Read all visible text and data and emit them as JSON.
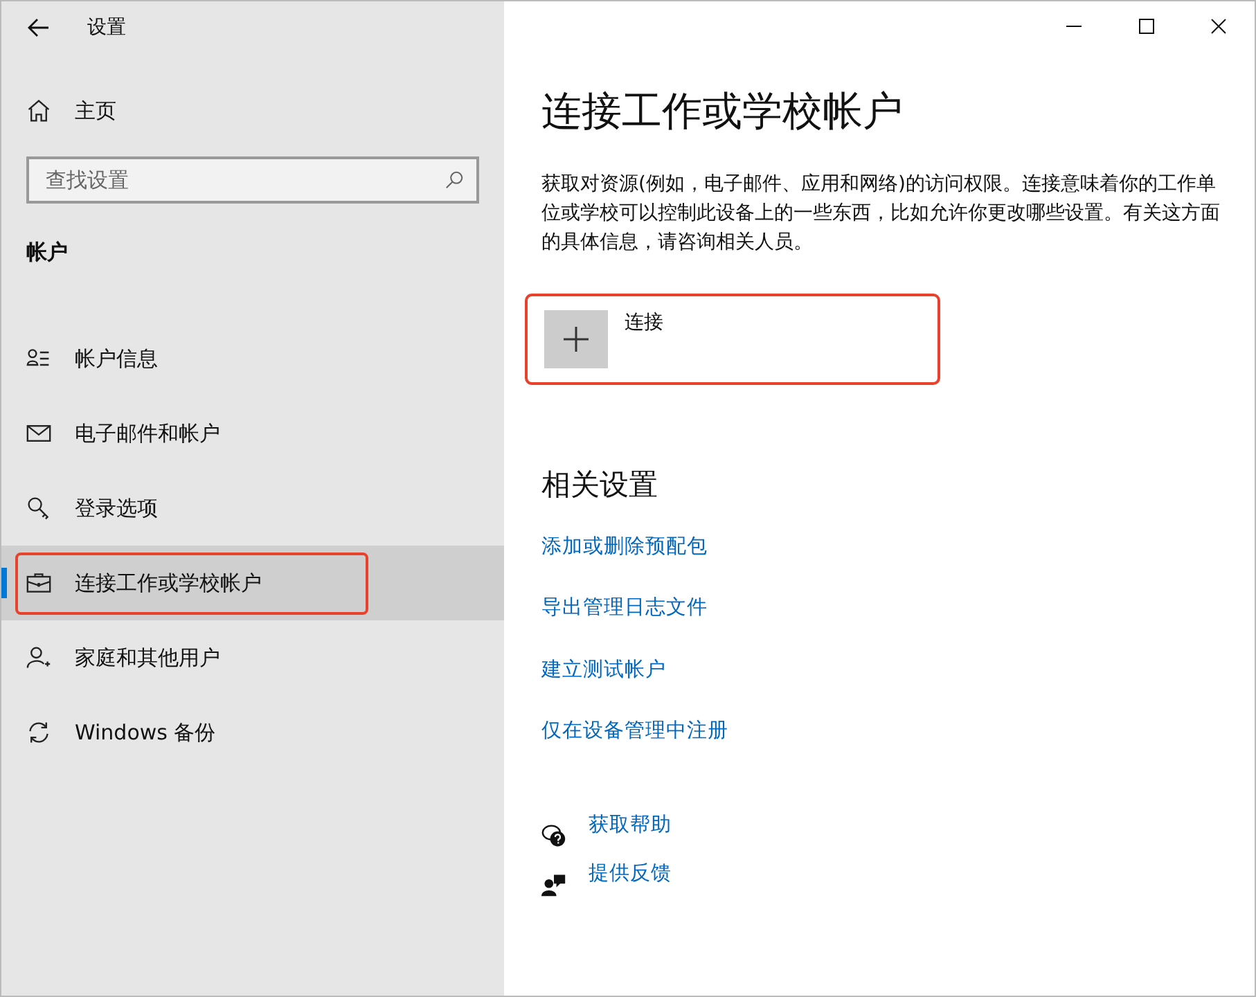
{
  "window": {
    "title": "设置"
  },
  "sidebar": {
    "home": "主页",
    "search": {
      "placeholder": "查找设置"
    },
    "section": "帐户",
    "items": [
      {
        "label": "帐户信息",
        "selected": false,
        "highlighted": false
      },
      {
        "label": "电子邮件和帐户",
        "selected": false,
        "highlighted": false
      },
      {
        "label": "登录选项",
        "selected": false,
        "highlighted": false
      },
      {
        "label": "连接工作或学校帐户",
        "selected": true,
        "highlighted": true
      },
      {
        "label": "家庭和其他用户",
        "selected": false,
        "highlighted": false
      },
      {
        "label": "Windows 备份",
        "selected": false,
        "highlighted": false
      }
    ]
  },
  "main": {
    "title": "连接工作或学校帐户",
    "description": "获取对资源(例如，电子邮件、应用和网络)的访问权限。连接意味着你的工作单位或学校可以控制此设备上的一些东西，比如允许你更改哪些设置。有关这方面的具体信息，请咨询相关人员。",
    "connect_button": {
      "label": "连接",
      "highlighted": true
    },
    "related_title": "相关设置",
    "related_links": [
      "添加或删除预配包",
      "导出管理日志文件",
      "建立测试帐户",
      "仅在设备管理中注册"
    ],
    "help_links": [
      "获取帮助",
      "提供反馈"
    ]
  }
}
